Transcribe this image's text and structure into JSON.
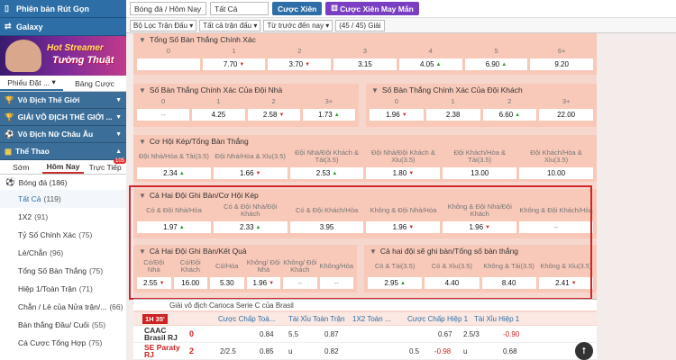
{
  "sidebar": {
    "top_items": [
      {
        "label": "Phiên bản Rút Gọn",
        "icon": "mobile-icon"
      },
      {
        "label": "Galaxy",
        "icon": "swap-icon"
      }
    ],
    "banner": {
      "line1": "Hot Streamer",
      "line2": "Tường Thuật"
    },
    "slip_tabs": [
      "Phiếu Đặt ...",
      "Bảng Cược"
    ],
    "leagues": [
      {
        "label": "Vô Địch Thế Giới"
      },
      {
        "label": "GIẢI VÔ ĐỊCH THẾ GIỚI ..."
      },
      {
        "label": "Vô Địch Nữ Châu Âu"
      }
    ],
    "sports_label": "Thể Thao",
    "time_tabs": [
      {
        "label": "Sớm"
      },
      {
        "label": "Hôm Nay",
        "active": true
      },
      {
        "label": "Trực Tiếp",
        "badge": "105"
      }
    ],
    "sport": {
      "label": "Bóng đá",
      "count": "(186)"
    },
    "markets": [
      {
        "label": "Tất Cả",
        "count": "(119)",
        "selected": true
      },
      {
        "label": "1X2",
        "count": "(91)"
      },
      {
        "label": "Tỷ Số Chính Xác",
        "count": "(75)"
      },
      {
        "label": "Lẻ/Chẵn",
        "count": "(96)"
      },
      {
        "label": "Tổng Số Bàn Thắng",
        "count": "(75)"
      },
      {
        "label": "Hiệp 1/Toàn Trận",
        "count": "(71)"
      },
      {
        "label": "Chẵn / Lẻ của Nửa trận/...",
        "count": "(66)"
      },
      {
        "label": "Bàn thắng Đầu/ Cuối",
        "count": "(55)"
      },
      {
        "label": "Cá Cược Tổng Hợp",
        "count": "(75)"
      }
    ]
  },
  "topbar": {
    "sport_select": "Bóng đá / Hôm Nay",
    "all_select": "Tất Cả",
    "parlay_btn": "Cược Xiên",
    "lucky_parlay_btn": "Cược Xiên May Mắn"
  },
  "filterbar": {
    "match_filter": "Bộ Lọc Trận Đấu",
    "sort_select": "Tất cả trận đấu",
    "time_select": "Từ trước đến nay",
    "count": "(45 / 45) Giải"
  },
  "sections": {
    "exact_goals": {
      "title": "Tổng Số Bàn Thắng Chính Xác",
      "headers": [
        "0",
        "1",
        "2",
        "3",
        "4",
        "5",
        "6+"
      ],
      "odds": [
        "",
        "7.70",
        "3.70",
        "3.15",
        "4.05",
        "6.90",
        "9.20"
      ],
      "arrows": [
        "",
        "down",
        "down",
        "",
        "up",
        "up",
        ""
      ]
    },
    "home_exact": {
      "title": "Số Bàn Thắng Chính Xác Của Đội Nhà",
      "headers": [
        "0",
        "1",
        "2",
        "3+"
      ],
      "odds": [
        "--",
        "4.25",
        "2.58",
        "1.73"
      ],
      "arrows": [
        "",
        "",
        "down",
        "up"
      ]
    },
    "away_exact": {
      "title": "Số Bàn Thắng Chính Xác Của Đội Khách",
      "headers": [
        "0",
        "1",
        "2",
        "3+"
      ],
      "odds": [
        "1.96",
        "2.38",
        "6.60",
        "22.00"
      ],
      "arrows": [
        "down",
        "",
        "up",
        ""
      ]
    },
    "dc_total": {
      "title": "Cơ Hội Kép/Tổng Bàn Thắng",
      "headers": [
        "Đội Nhà/Hòa & Tài(3.5)",
        "Đội Nhà/Hòa & Xỉu(3.5)",
        "Đội Nhà/Đội Khách & Tài(3.5)",
        "Đội Nhà/Đội Khách & Xỉu(3.5)",
        "Đội Khách/Hòa & Tài(3.5)",
        "Đội Khách/Hòa & Xỉu(3.5)"
      ],
      "odds": [
        "2.34",
        "1.66",
        "2.53",
        "1.80",
        "13.00",
        "10.00"
      ],
      "arrows": [
        "up",
        "down",
        "up",
        "down",
        "",
        ""
      ]
    },
    "btts_dc": {
      "title": "Cả Hai Đội Ghi Bàn/Cơ Hội Kép",
      "headers": [
        "Có & Đội Nhà/Hòa",
        "Có & Đội Nhà/Đội Khách",
        "Có & Đội Khách/Hòa",
        "Không & Đội Nhà/Hòa",
        "Không & Đội Nhà/Đội Khách",
        "Không & Đội Khách/Hòa"
      ],
      "odds": [
        "1.97",
        "2.33",
        "3.95",
        "1.96",
        "1.96",
        "--"
      ],
      "arrows": [
        "up",
        "up",
        "",
        "down",
        "down",
        ""
      ]
    },
    "btts_result": {
      "title": "Cả Hai Đội Ghi Bàn/Kết Quả",
      "headers": [
        "Có/Đội Nhà",
        "Có/Đội Khách",
        "Có/Hòa",
        "Không/ Đội Nhà",
        "Không/ Đội Khách",
        "Không/Hòa"
      ],
      "odds": [
        "2.55",
        "16.00",
        "5.30",
        "1.96",
        "--",
        "--"
      ],
      "arrows": [
        "down",
        "",
        "",
        "down",
        "",
        ""
      ]
    },
    "btts_total": {
      "title": "Cả hai đội sẽ ghi bàn/Tổng số bàn thắng",
      "headers": [
        "Có & Tài(3.5)",
        "Có & Xỉu(3.5)",
        "Không & Tài(3.5)",
        "Không & Xỉu(3.5)"
      ],
      "odds": [
        "2.95",
        "4.40",
        "8.40",
        "2.41"
      ],
      "arrows": [
        "up",
        "",
        "",
        "down"
      ]
    }
  },
  "league_title": "Giải vô địch Carioca Serie C của Brasil",
  "match_header": {
    "live": "1H 35'",
    "cols": [
      "Cược Chấp Toà...",
      "Tài Xỉu Toàn Trận",
      "1X2 Toàn ...",
      "Cược Chấp Hiệp 1",
      "Tài Xỉu Hiệp 1"
    ]
  },
  "matches": [
    {
      "team": "CAAC Brasil RJ",
      "score": "0",
      "hdp": "",
      "hdp_odds": "0.84",
      "ou": "5.5",
      "ou_odds": "0.87",
      "h1_odds": "0.67",
      "h1_ou": "2.5/3",
      "h1_ou_odds": "-0.90"
    },
    {
      "team": "SE Paraty RJ",
      "score": "2",
      "hdp": "2/2.5",
      "hdp_odds": "0.85",
      "ou": "u",
      "ou_odds": "0.82",
      "h1_hdp": "0.5",
      "h1_odds": "-0.98",
      "h1_ou": "u",
      "h1_ou_odds": "0.68"
    }
  ]
}
